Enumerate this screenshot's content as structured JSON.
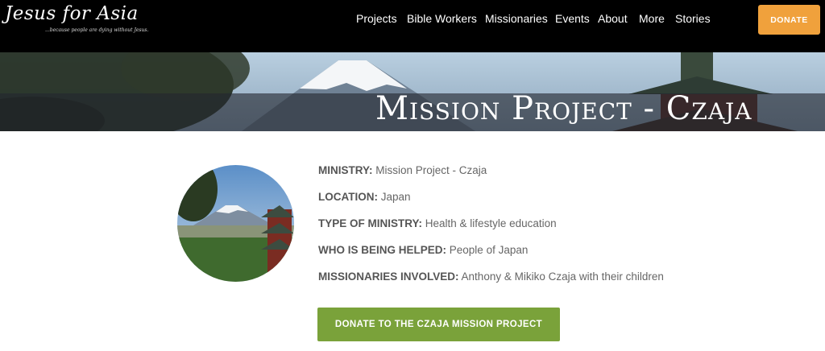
{
  "header": {
    "logo_title": "Jesus for Asia",
    "logo_tagline": "...because people are dying without Jesus.",
    "nav": [
      "Projects",
      "Bible Workers",
      "Missionaries",
      "Events",
      "About",
      "More",
      "Stories"
    ],
    "donate_label": "DONATE"
  },
  "banner": {
    "title": "Mission Project - Czaja"
  },
  "details": [
    {
      "label": "MINISTRY:",
      "value": "Mission Project - Czaja"
    },
    {
      "label": "LOCATION:",
      "value": "Japan"
    },
    {
      "label": "TYPE OF MINISTRY:",
      "value": "Health & lifestyle education"
    },
    {
      "label": "WHO IS BEING HELPED:",
      "value": "People of Japan"
    },
    {
      "label": "MISSIONARIES INVOLVED:",
      "value": "Anthony & Mikiko Czaja with their children"
    }
  ],
  "cta_label": "DONATE TO THE CZAJA MISSION PROJECT",
  "colors": {
    "header_bg": "#000000",
    "donate_orange": "#f0a13c",
    "cta_green": "#7aa23a"
  }
}
